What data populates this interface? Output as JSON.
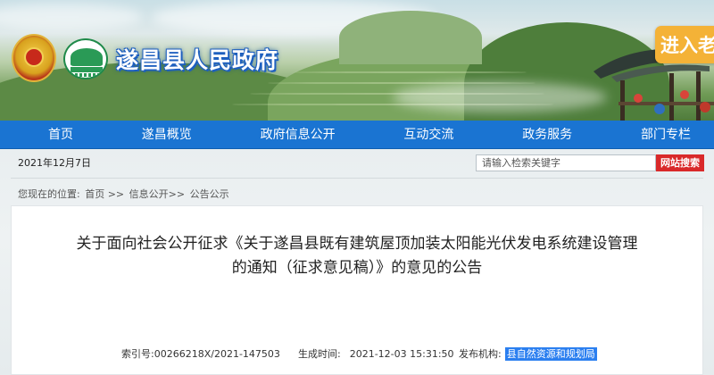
{
  "header": {
    "site_title": "遂昌县人民政府",
    "care_mode_label": "进入老"
  },
  "nav": {
    "items": [
      "首页",
      "遂昌概览",
      "政府信息公开",
      "互动交流",
      "政务服务",
      "部门专栏"
    ]
  },
  "toolbar": {
    "date": "2021年12月7日",
    "search_placeholder": "请输入检索关键字",
    "search_button": "网站搜索"
  },
  "breadcrumb": {
    "prefix": "您现在的位置:",
    "items": [
      "首页 >>",
      "信息公开>>",
      "公告公示"
    ]
  },
  "article": {
    "title_line1": "关于面向社会公开征求《关于遂昌县既有建筑屋顶加装太阳能光伏发电系统建设管理",
    "title_line2": "的通知（征求意见稿）》的意见的公告"
  },
  "meta": {
    "index_label": "索引号:",
    "index_value": "00266218X/2021-147503",
    "time_label": "生成时间:",
    "time_value": "2021-12-03 15:31:50",
    "org_label": "发布机构:",
    "org_value": "县自然资源和规划局"
  },
  "colors": {
    "nav_bg": "#1a74d2",
    "search_button": "#d9292a",
    "care_button": "#f4b237",
    "highlight": "#2b7ff0"
  }
}
